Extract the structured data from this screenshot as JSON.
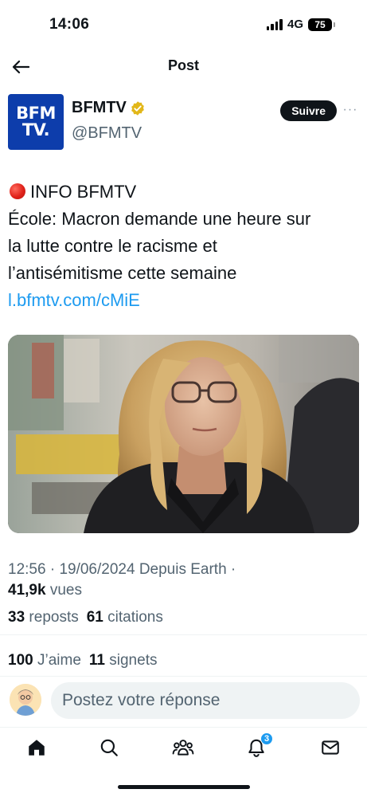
{
  "status_bar": {
    "time": "14:06",
    "network": "4G",
    "battery": "75"
  },
  "header": {
    "title": "Post"
  },
  "author": {
    "display_name": "BFMTV",
    "handle": "@BFMTV",
    "avatar_line1": "BFM",
    "avatar_line2": "TV.",
    "follow_label": "Suivre",
    "more_label": "···"
  },
  "tweet": {
    "line1": "INFO BFMTV",
    "line2": "École: Macron demande une heure sur",
    "line3": "la lutte contre le racisme et",
    "line4": "l’antisémitisme cette semaine",
    "link": "l.bfmtv.com/cMiE"
  },
  "meta": {
    "time": "12:56",
    "date": "19/06/2024",
    "source": "Depuis Earth",
    "views_count": "41,9k",
    "views_label": "vues"
  },
  "stats": {
    "reposts_count": "33",
    "reposts_label": "reposts",
    "quotes_count": "61",
    "quotes_label": "citations",
    "likes_count": "100",
    "likes_label": "J’aime",
    "bookmarks_count": "11",
    "bookmarks_label": "signets"
  },
  "reply": {
    "placeholder": "Postez votre réponse"
  },
  "tabbar": {
    "notifications_badge": "3"
  },
  "colors": {
    "accent": "#1d9bf0",
    "bfm_blue": "#0d3dab",
    "verified_gold": "#e2b719"
  },
  "icons": [
    "back-arrow-icon",
    "verified-badge-icon",
    "home-icon",
    "search-icon",
    "communities-icon",
    "bell-icon",
    "mail-icon"
  ]
}
